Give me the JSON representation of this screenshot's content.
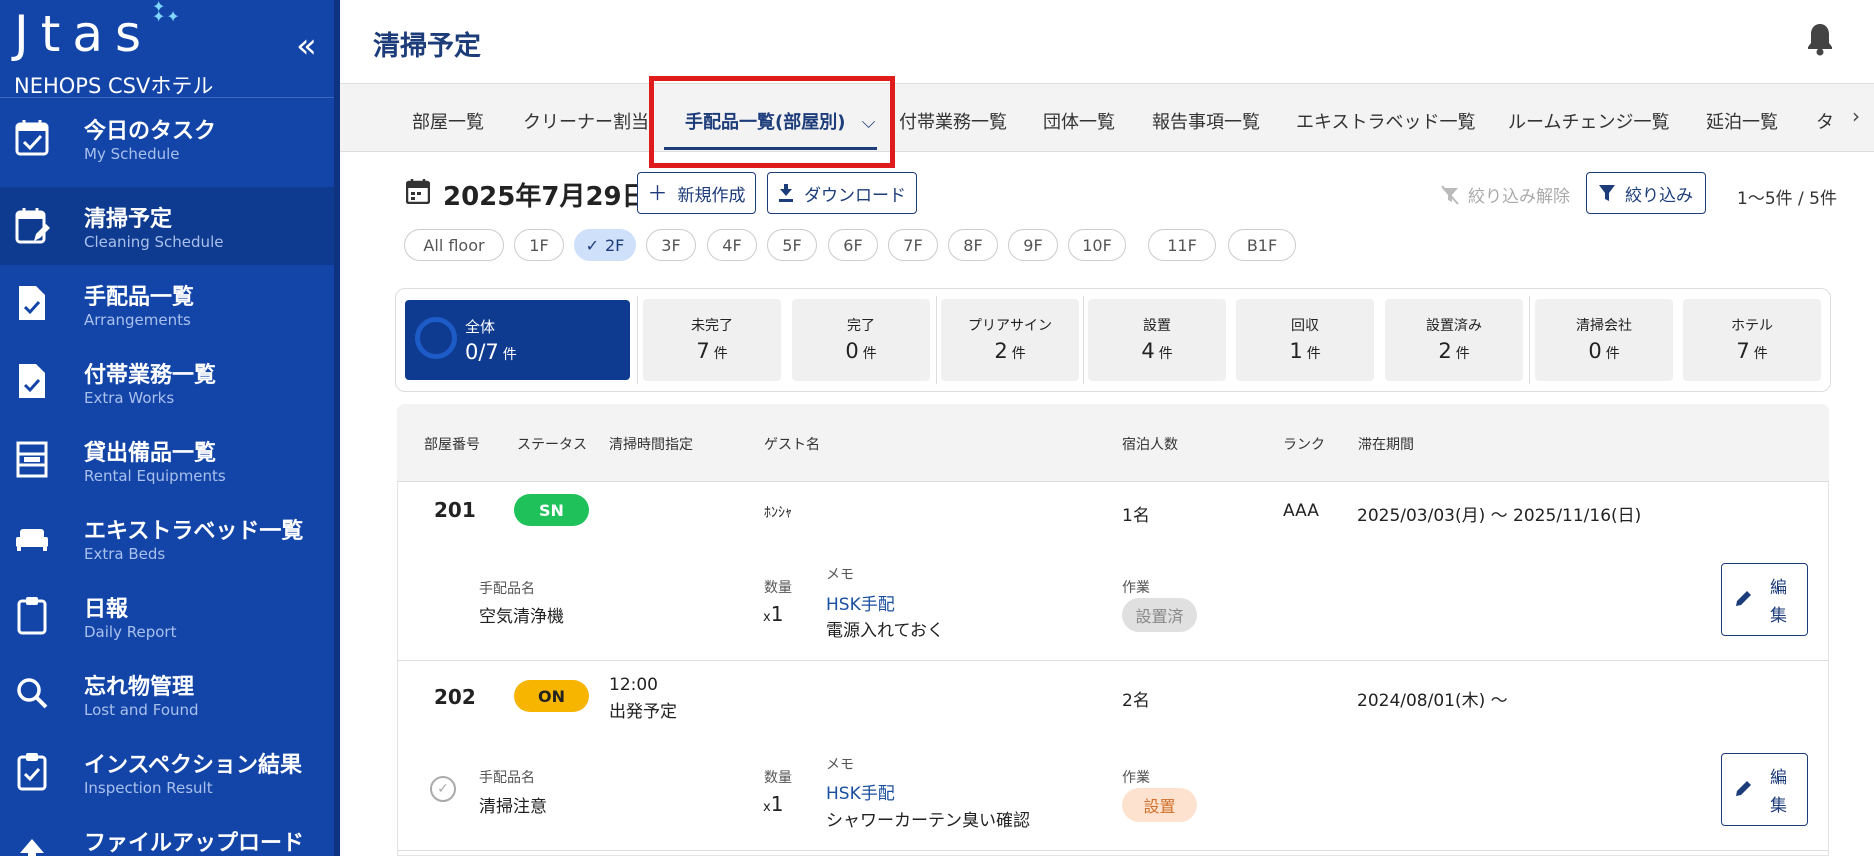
{
  "sidebar": {
    "logo": "Jtas",
    "hotel": "NEHOPS CSVホテル",
    "collapse_icon": "«",
    "items": [
      {
        "title": "今日のタスク",
        "sub": "My Schedule",
        "icon": "calendar-check-icon"
      },
      {
        "title": "清掃予定",
        "sub": "Cleaning Schedule",
        "icon": "calendar-edit-icon",
        "active": true
      },
      {
        "title": "手配品一覧",
        "sub": "Arrangements",
        "icon": "document-check-icon"
      },
      {
        "title": "付帯業務一覧",
        "sub": "Extra Works",
        "icon": "document-check-icon"
      },
      {
        "title": "貸出備品一覧",
        "sub": "Rental Equipments",
        "icon": "shelf-icon"
      },
      {
        "title": "エキストラベッド一覧",
        "sub": "Extra Beds",
        "icon": "bed-icon"
      },
      {
        "title": "日報",
        "sub": "Daily Report",
        "icon": "clipboard-icon"
      },
      {
        "title": "忘れ物管理",
        "sub": "Lost and Found",
        "icon": "search-icon"
      },
      {
        "title": "インスペクション結果",
        "sub": "Inspection Result",
        "icon": "clipboard-check-icon"
      },
      {
        "title": "ファイルアップロード",
        "sub": "",
        "icon": "upload-icon"
      }
    ]
  },
  "header": {
    "title": "清掃予定"
  },
  "tabs": [
    "部屋一覧",
    "クリーナー割当",
    "手配品一覧(部屋別)",
    "付帯業務一覧",
    "団体一覧",
    "報告事項一覧",
    "エキストラベッド一覧",
    "ルームチェンジ一覧",
    "延泊一覧",
    "タ"
  ],
  "toolbar": {
    "date": "2025年7月29日",
    "new_label": "新規作成",
    "download_label": "ダウンロード",
    "clear_filter_label": "絞り込み解除",
    "filter_label": "絞り込み",
    "count": "1〜5件 / 5件"
  },
  "floors": [
    "All floor",
    "1F",
    "2F",
    "3F",
    "4F",
    "5F",
    "6F",
    "7F",
    "8F",
    "9F",
    "10F",
    "11F",
    "B1F"
  ],
  "selected_floor": "2F",
  "stats": {
    "total": {
      "label": "全体",
      "value": "0/7",
      "unit": "件"
    },
    "cards": [
      {
        "label": "未完了",
        "value": "7",
        "unit": "件"
      },
      {
        "label": "完了",
        "value": "0",
        "unit": "件"
      },
      {
        "label": "プリアサイン",
        "value": "2",
        "unit": "件"
      },
      {
        "label": "設置",
        "value": "4",
        "unit": "件"
      },
      {
        "label": "回収",
        "value": "1",
        "unit": "件"
      },
      {
        "label": "設置済み",
        "value": "2",
        "unit": "件"
      },
      {
        "label": "清掃会社",
        "value": "0",
        "unit": "件"
      },
      {
        "label": "ホテル",
        "value": "7",
        "unit": "件"
      }
    ]
  },
  "table": {
    "headers": [
      "部屋番号",
      "ステータス",
      "清掃時間指定",
      "ゲスト名",
      "宿泊人数",
      "ランク",
      "滞在期間"
    ],
    "rows": [
      {
        "room": "201",
        "status": "SN",
        "status_color": "#1fc15a",
        "time": "",
        "time_note": "",
        "guest": "ﾎﾝｼｬ",
        "guests": "1名",
        "rank": "AAA",
        "stay": "2025/03/03(月) 〜 2025/11/16(日)",
        "item_label": "手配品名",
        "item": "空気清浄機",
        "qty_label": "数量",
        "qty_x": "x",
        "qty": "1",
        "memo_label": "メモ",
        "memo_link": "HSK手配",
        "memo": "電源入れておく",
        "work_label": "作業",
        "work": "設置済",
        "work_bg": "#e0e0e0",
        "work_color": "#888888",
        "edit_label": "編集"
      },
      {
        "room": "202",
        "status": "ON",
        "status_color": "#f7b500",
        "time": "12:00",
        "time_note": "出発予定",
        "guest": "",
        "guests": "2名",
        "rank": "",
        "stay": "2024/08/01(木) 〜",
        "item_label": "手配品名",
        "item": "清掃注意",
        "qty_label": "数量",
        "qty_x": "x",
        "qty": "1",
        "memo_label": "メモ",
        "memo_link": "HSK手配",
        "memo": "シャワーカーテン臭い確認",
        "work_label": "作業",
        "work": "設置",
        "work_bg": "#fde3cf",
        "work_color": "#d0702a",
        "edit_label": "編集"
      }
    ]
  }
}
